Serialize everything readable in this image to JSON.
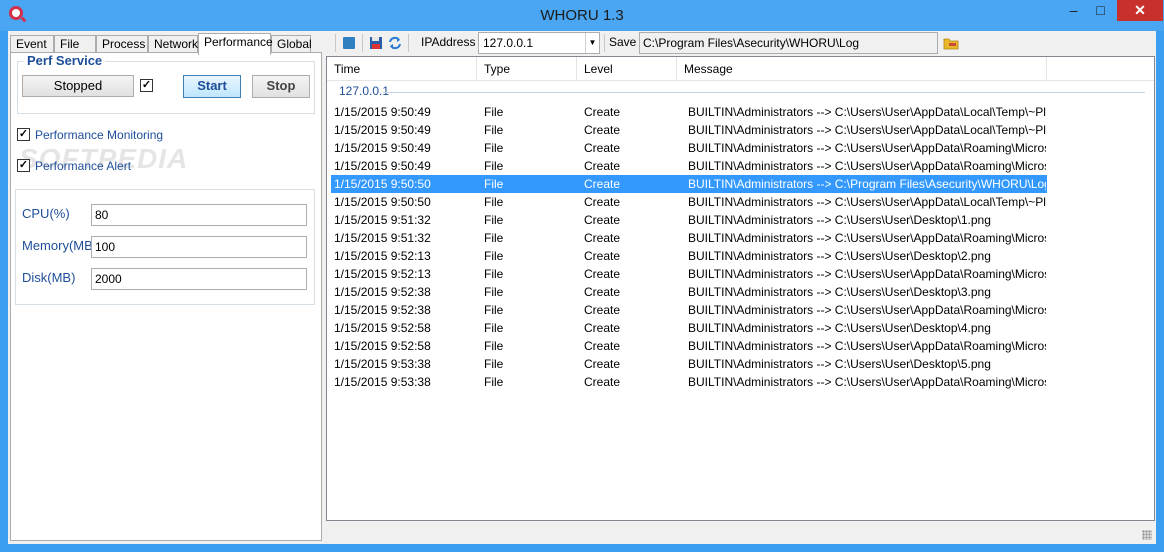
{
  "window": {
    "title": "WHORU 1.3",
    "minimize": "–",
    "maximize": "□",
    "close": "✕"
  },
  "tabs": [
    "Event",
    "File",
    "Process",
    "Network",
    "Performance",
    "Global"
  ],
  "perf_service": {
    "title": "Perf Service",
    "status": "Stopped",
    "status_checked": "✓",
    "start_label": "Start",
    "stop_label": "Stop"
  },
  "options": {
    "monitoring_label": "Performance Monitoring",
    "monitoring_checked": "✓",
    "alert_label": "Performance Alert",
    "alert_checked": "✓"
  },
  "thresholds": {
    "cpu_label": "CPU(%)",
    "cpu_value": "80",
    "memory_label": "Memory(MB",
    "memory_value": "100",
    "disk_label": "Disk(MB)",
    "disk_value": "2000"
  },
  "toolbar": {
    "ip_label": "IPAddress",
    "ip_value": "127.0.0.1",
    "save_label": "Save",
    "save_path": "C:\\Program Files\\Asecurity\\WHORU\\Log"
  },
  "list": {
    "columns": [
      "Time",
      "Type",
      "Level",
      "Message"
    ],
    "group": "127.0.0.1",
    "rows": [
      {
        "time": "1/15/2015 9:50:49",
        "type": "File",
        "level": "Create",
        "message": "BUILTIN\\Administrators --> C:\\Users\\User\\AppData\\Local\\Temp\\~Pl..."
      },
      {
        "time": "1/15/2015 9:50:49",
        "type": "File",
        "level": "Create",
        "message": "BUILTIN\\Administrators --> C:\\Users\\User\\AppData\\Local\\Temp\\~Pl..."
      },
      {
        "time": "1/15/2015 9:50:49",
        "type": "File",
        "level": "Create",
        "message": "BUILTIN\\Administrators --> C:\\Users\\User\\AppData\\Roaming\\Microso..."
      },
      {
        "time": "1/15/2015 9:50:49",
        "type": "File",
        "level": "Create",
        "message": "BUILTIN\\Administrators --> C:\\Users\\User\\AppData\\Roaming\\Microso..."
      },
      {
        "time": "1/15/2015 9:50:50",
        "type": "File",
        "level": "Create",
        "message": "BUILTIN\\Administrators --> C:\\Program Files\\Asecurity\\WHORU\\Log\\W..."
      },
      {
        "time": "1/15/2015 9:50:50",
        "type": "File",
        "level": "Create",
        "message": "BUILTIN\\Administrators --> C:\\Users\\User\\AppData\\Local\\Temp\\~Pl..."
      },
      {
        "time": "1/15/2015 9:51:32",
        "type": "File",
        "level": "Create",
        "message": "BUILTIN\\Administrators --> C:\\Users\\User\\Desktop\\1.png"
      },
      {
        "time": "1/15/2015 9:51:32",
        "type": "File",
        "level": "Create",
        "message": "BUILTIN\\Administrators --> C:\\Users\\User\\AppData\\Roaming\\Microso..."
      },
      {
        "time": "1/15/2015 9:52:13",
        "type": "File",
        "level": "Create",
        "message": "BUILTIN\\Administrators --> C:\\Users\\User\\Desktop\\2.png"
      },
      {
        "time": "1/15/2015 9:52:13",
        "type": "File",
        "level": "Create",
        "message": "BUILTIN\\Administrators --> C:\\Users\\User\\AppData\\Roaming\\Microso..."
      },
      {
        "time": "1/15/2015 9:52:38",
        "type": "File",
        "level": "Create",
        "message": "BUILTIN\\Administrators --> C:\\Users\\User\\Desktop\\3.png"
      },
      {
        "time": "1/15/2015 9:52:38",
        "type": "File",
        "level": "Create",
        "message": "BUILTIN\\Administrators --> C:\\Users\\User\\AppData\\Roaming\\Microso..."
      },
      {
        "time": "1/15/2015 9:52:58",
        "type": "File",
        "level": "Create",
        "message": "BUILTIN\\Administrators --> C:\\Users\\User\\Desktop\\4.png"
      },
      {
        "time": "1/15/2015 9:52:58",
        "type": "File",
        "level": "Create",
        "message": "BUILTIN\\Administrators --> C:\\Users\\User\\AppData\\Roaming\\Microso..."
      },
      {
        "time": "1/15/2015 9:53:38",
        "type": "File",
        "level": "Create",
        "message": "BUILTIN\\Administrators --> C:\\Users\\User\\Desktop\\5.png"
      },
      {
        "time": "1/15/2015 9:53:38",
        "type": "File",
        "level": "Create",
        "message": "BUILTIN\\Administrators --> C:\\Users\\User\\AppData\\Roaming\\Microso..."
      }
    ],
    "selected_index": 4
  },
  "colors": {
    "titlebar": "#4aa6f2",
    "accent": "#1e4e9a",
    "selection": "#3399ff",
    "close": "#c7302b"
  }
}
